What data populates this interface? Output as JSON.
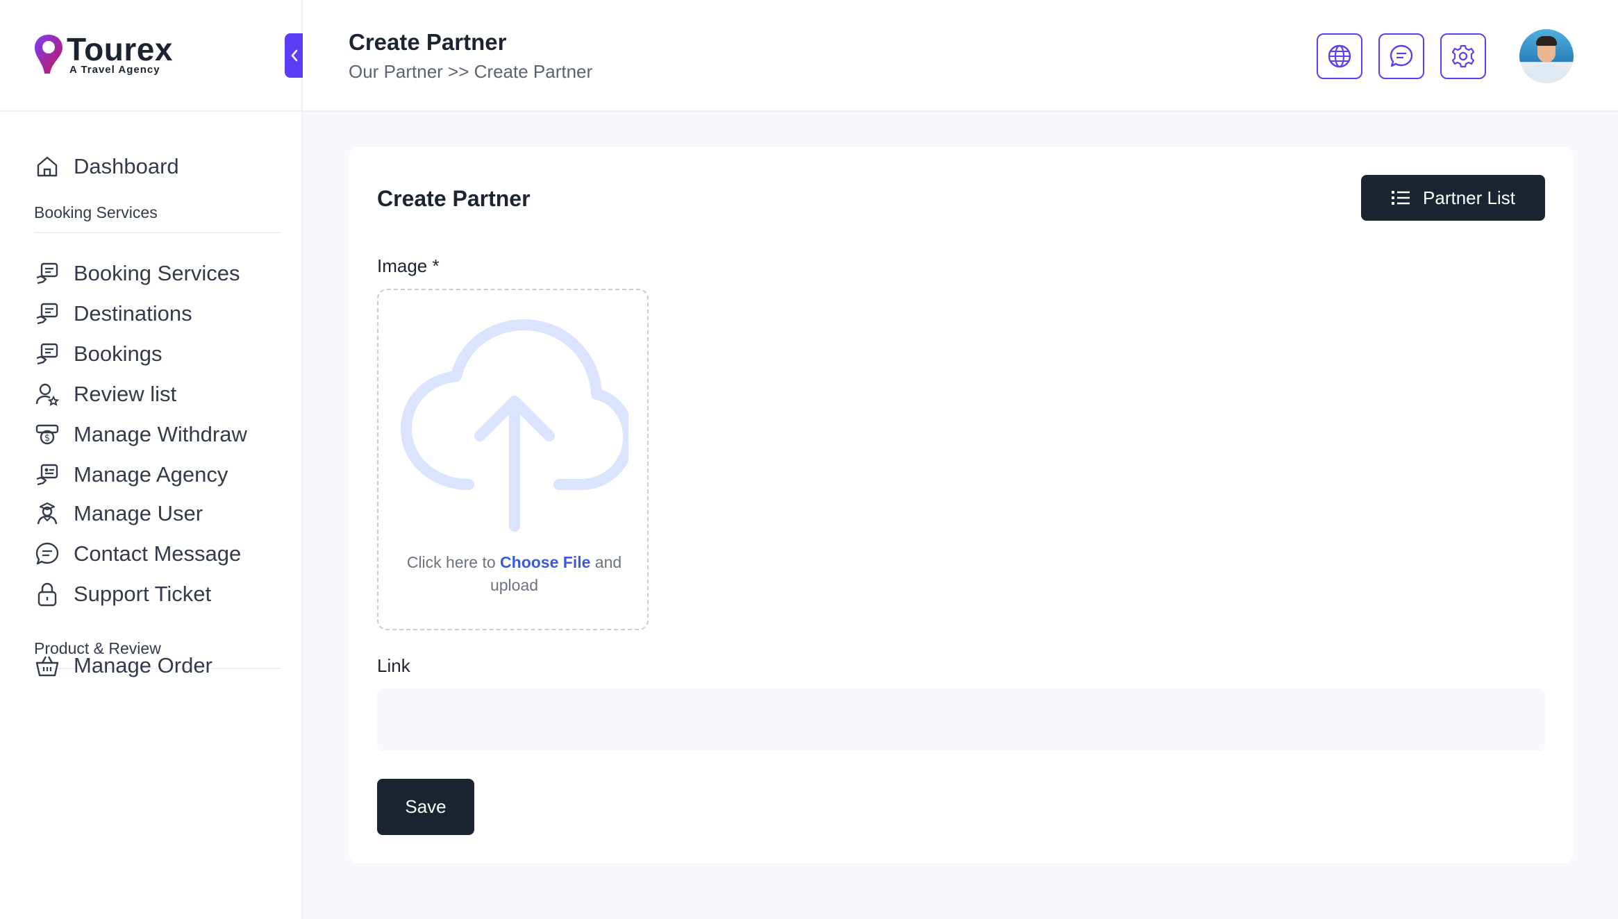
{
  "brand": {
    "name": "Tourex",
    "tagline": "A Travel Agency",
    "accent_color": "#5b3df5",
    "dark_color": "#1b2430"
  },
  "sidebar": {
    "items": [
      {
        "label": "Dashboard",
        "icon": "home-icon"
      },
      {
        "label": "Booking Services",
        "icon": "hand-card-icon"
      },
      {
        "label": "Destinations",
        "icon": "hand-card-icon"
      },
      {
        "label": "Bookings",
        "icon": "hand-card-icon"
      },
      {
        "label": "Review list",
        "icon": "user-star-icon"
      },
      {
        "label": "Manage Withdraw",
        "icon": "money-icon"
      },
      {
        "label": "Manage Agency",
        "icon": "agency-icon"
      },
      {
        "label": "Manage User",
        "icon": "user-icon"
      },
      {
        "label": "Contact Message",
        "icon": "chat-icon"
      },
      {
        "label": "Support Ticket",
        "icon": "lock-icon"
      },
      {
        "label": "Manage Order",
        "icon": "basket-icon"
      }
    ],
    "sections": [
      "Booking Services",
      "Product & Review"
    ]
  },
  "header": {
    "title": "Create Partner",
    "breadcrumb": "Our Partner >> Create Partner",
    "actions": [
      "globe-icon",
      "chat-icon",
      "gear-icon"
    ]
  },
  "form": {
    "title": "Create Partner",
    "list_button": "Partner List",
    "image_label": "Image *",
    "upload_prefix": "Click here to ",
    "upload_link": "Choose File",
    "upload_suffix": " and upload",
    "link_label": "Link",
    "link_value": "",
    "save_label": "Save"
  }
}
